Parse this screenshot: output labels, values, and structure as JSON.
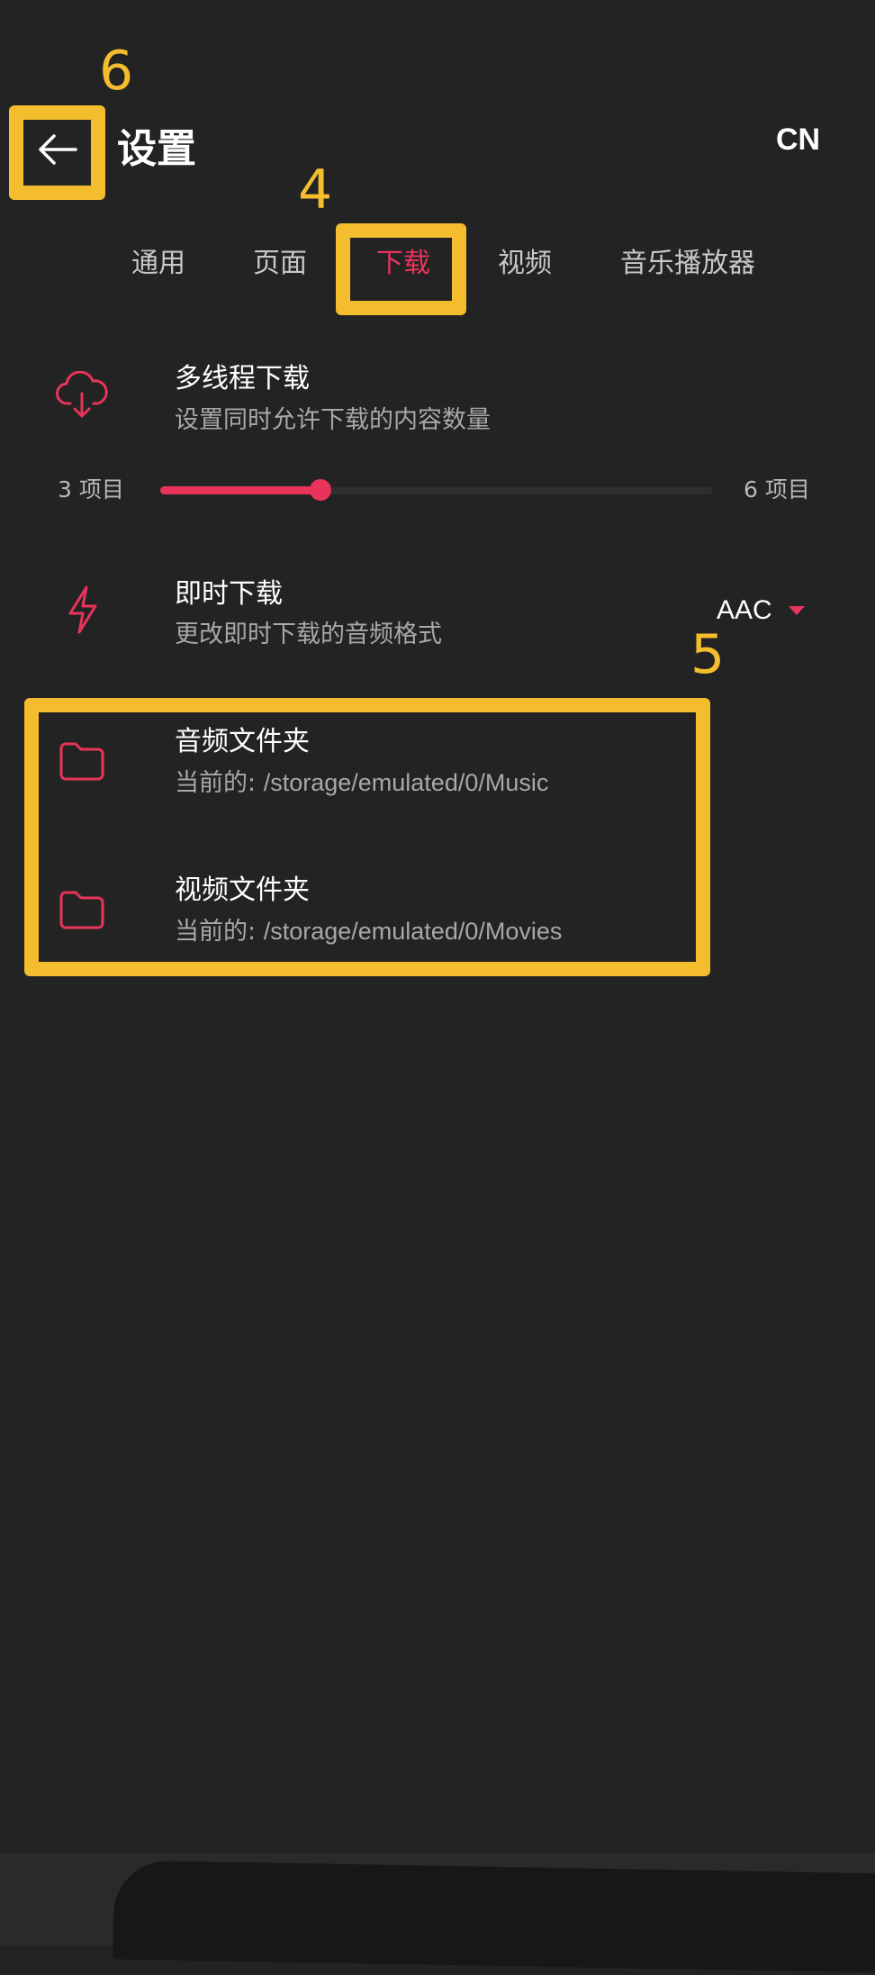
{
  "header": {
    "title": "设置",
    "language": "CN"
  },
  "tabs": [
    {
      "label": "通用",
      "active": false
    },
    {
      "label": "页面",
      "active": false
    },
    {
      "label": "下载",
      "active": true
    },
    {
      "label": "视频",
      "active": false
    },
    {
      "label": "音乐播放器",
      "active": false
    }
  ],
  "multithread": {
    "title": "多线程下载",
    "subtitle": "设置同时允许下载的内容数量",
    "min_label": "3 项目",
    "max_label": "6 项目",
    "slider_fraction": 0.29
  },
  "instant": {
    "title": "即时下载",
    "subtitle": "更改即时下载的音频格式",
    "format": "AAC"
  },
  "folders": [
    {
      "title": "音频文件夹",
      "prefix": "当前的:",
      "path": "/storage/emulated/0/Music"
    },
    {
      "title": "视频文件夹",
      "prefix": "当前的:",
      "path": "/storage/emulated/0/Movies"
    }
  ],
  "annotations": {
    "back": "6",
    "tab": "4",
    "folders": "5"
  },
  "colors": {
    "accent": "#e8345b",
    "annotation": "#f3bd2e",
    "background": "#232323"
  },
  "icons": {
    "back": "arrow-left-icon",
    "download": "cloud-download-icon",
    "instant": "lightning-icon",
    "folder": "folder-icon"
  }
}
